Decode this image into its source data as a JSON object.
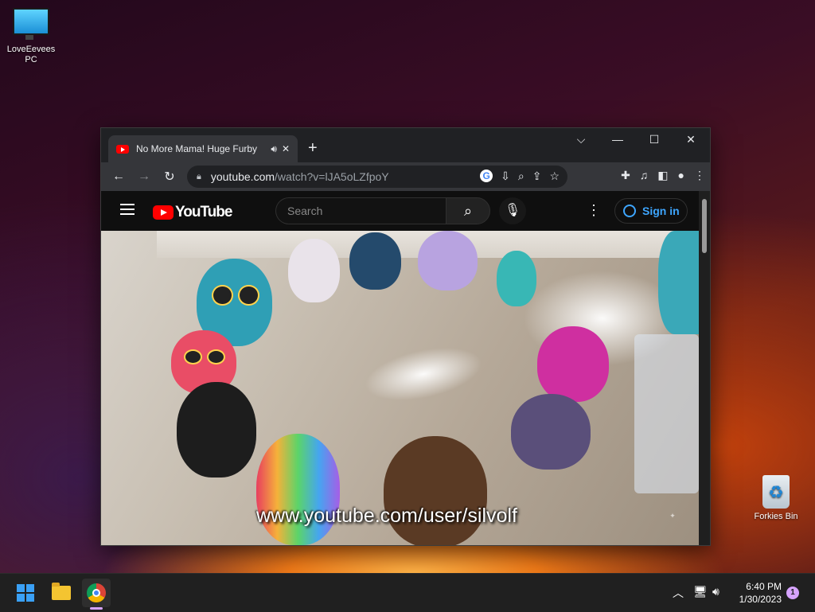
{
  "desktop": {
    "icons": [
      {
        "label": "LoveEevees PC"
      },
      {
        "label": "Forkies Bin"
      }
    ]
  },
  "browser": {
    "tab": {
      "title": "No More Mama! Huge Furby",
      "audio_icon": "speaker-icon"
    },
    "new_tab_symbol": "+",
    "window_controls": {
      "dropdown": "⌵",
      "minimize": "—",
      "maximize": "☐",
      "close": "✕"
    },
    "address": {
      "host": "youtube.com",
      "path": "/watch?v=lJA5oLZfpoY"
    }
  },
  "youtube": {
    "logo_text": "YouTube",
    "search_placeholder": "Search",
    "sign_in": "Sign in"
  },
  "video": {
    "caption": "www.youtube.com/user/silvolf"
  },
  "taskbar": {
    "time": "6:40 PM",
    "date": "1/30/2023",
    "notification_count": "1"
  }
}
